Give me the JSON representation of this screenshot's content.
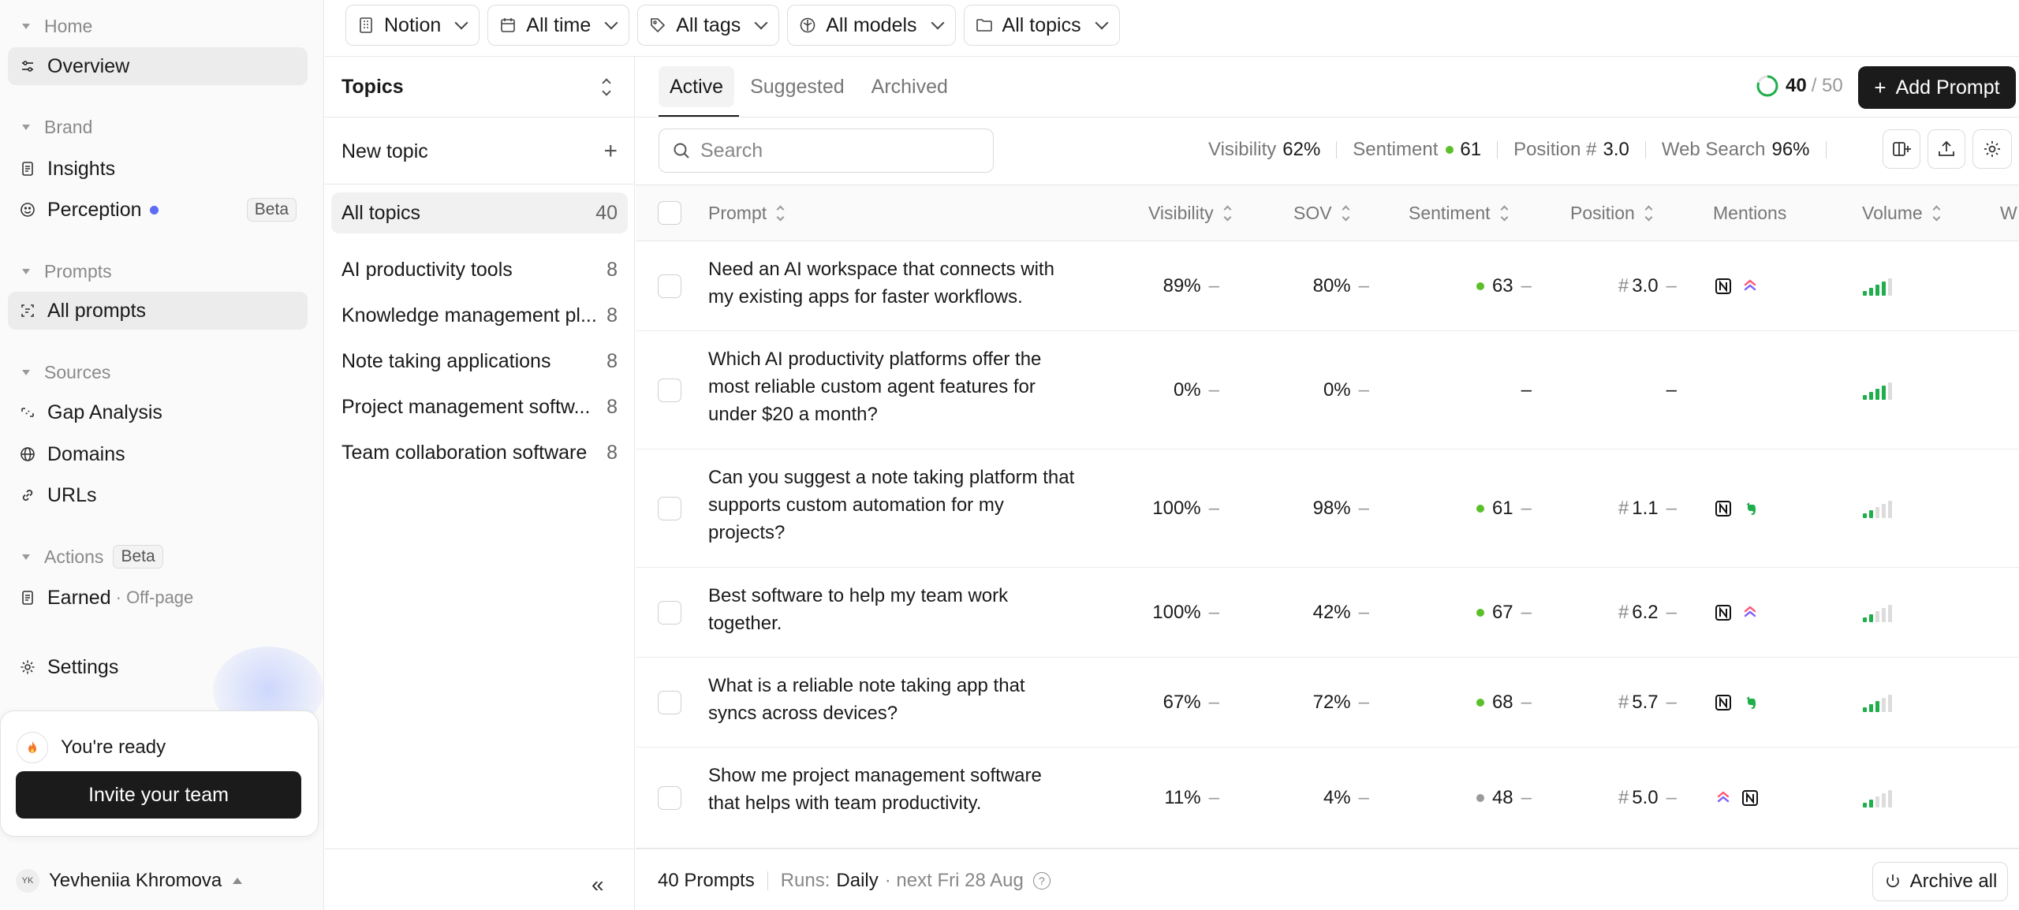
{
  "sidebar": {
    "sections": [
      {
        "label": "Home"
      },
      {
        "label": "Brand"
      },
      {
        "label": "Prompts"
      },
      {
        "label": "Sources"
      },
      {
        "label": "Actions",
        "badge": "Beta"
      }
    ],
    "items": {
      "overview": "Overview",
      "insights": "Insights",
      "perception": "Perception",
      "perception_badge": "Beta",
      "all_prompts": "All prompts",
      "gap_analysis": "Gap Analysis",
      "domains": "Domains",
      "urls": "URLs",
      "earned": "Earned",
      "earned_sub": "· Off-page",
      "settings": "Settings"
    },
    "ready": {
      "title": "You're ready",
      "button": "Invite your team"
    },
    "user": {
      "initials": "YK",
      "name": "Yevheniia Khromova"
    }
  },
  "filters": [
    {
      "label": "Notion",
      "icon": "building-icon"
    },
    {
      "label": "All time",
      "icon": "calendar-icon"
    },
    {
      "label": "All tags",
      "icon": "tag-icon"
    },
    {
      "label": "All models",
      "icon": "model-icon"
    },
    {
      "label": "All topics",
      "icon": "folder-icon"
    }
  ],
  "topics": {
    "header": "Topics",
    "new_topic": "New topic",
    "all": {
      "label": "All topics",
      "count": "40"
    },
    "list": [
      {
        "label": "AI productivity tools",
        "count": "8"
      },
      {
        "label": "Knowledge management pl...",
        "count": "8"
      },
      {
        "label": "Note taking applications",
        "count": "8"
      },
      {
        "label": "Project management softw...",
        "count": "8"
      },
      {
        "label": "Team collaboration software",
        "count": "8"
      }
    ]
  },
  "tabs": [
    "Active",
    "Suggested",
    "Archived"
  ],
  "progress": {
    "current": "40",
    "total": "/ 50",
    "fraction": 0.8
  },
  "add_prompt": "Add Prompt",
  "search": {
    "placeholder": "Search",
    "value": ""
  },
  "stats": {
    "visibility_label": "Visibility",
    "visibility": "62%",
    "sentiment_label": "Sentiment",
    "sentiment": "61",
    "position_label": "Position #",
    "position": "3.0",
    "web_search_label": "Web Search",
    "web_search": "96%"
  },
  "columns": [
    "Prompt",
    "Visibility",
    "SOV",
    "Sentiment",
    "Position",
    "Mentions",
    "Volume",
    "W"
  ],
  "rows": [
    {
      "prompt": [
        "Need an AI workspace that connects with",
        "my existing apps for faster workflows."
      ],
      "visibility": "89%",
      "sov": "80%",
      "sentiment": "63",
      "sentiment_color": "#5bbf2a",
      "position": "3.0",
      "mentions": [
        "notion-icon",
        "clickup-icon"
      ],
      "volume": 4
    },
    {
      "prompt": [
        "Which AI productivity platforms offer the",
        "most reliable custom agent features for",
        "under $20 a month?"
      ],
      "visibility": "0%",
      "sov": "0%",
      "sentiment": "–",
      "sentiment_color": "",
      "position": "–",
      "mentions": [],
      "volume": 4
    },
    {
      "prompt": [
        "Can you suggest a note taking platform that",
        "supports custom automation for my",
        "projects?"
      ],
      "visibility": "100%",
      "sov": "98%",
      "sentiment": "61",
      "sentiment_color": "#5bbf2a",
      "position": "1.1",
      "mentions": [
        "notion-icon",
        "evernote-icon"
      ],
      "volume": 2
    },
    {
      "prompt": [
        "Best software to help my team work",
        "together."
      ],
      "visibility": "100%",
      "sov": "42%",
      "sentiment": "67",
      "sentiment_color": "#5bbf2a",
      "position": "6.2",
      "mentions": [
        "notion-icon",
        "clickup-icon"
      ],
      "volume": 2
    },
    {
      "prompt": [
        "What is a reliable note taking app that",
        "syncs across devices?"
      ],
      "visibility": "67%",
      "sov": "72%",
      "sentiment": "68",
      "sentiment_color": "#5bbf2a",
      "position": "5.7",
      "mentions": [
        "notion-icon",
        "evernote-icon"
      ],
      "volume": 3
    },
    {
      "prompt": [
        "Show me project management software",
        "that helps with team productivity."
      ],
      "visibility": "11%",
      "sov": "4%",
      "sentiment": "48",
      "sentiment_color": "#9a9a9a",
      "position": "5.0",
      "mentions": [
        "clickup-icon",
        "notion-icon"
      ],
      "volume": 2
    }
  ],
  "footer": {
    "count": "40 Prompts",
    "runs_label": "Runs:",
    "runs_value": "Daily",
    "next": "· next Fri 28 Aug",
    "archive_all": "Archive all"
  },
  "colors": {
    "accent": "#1b1b1b",
    "positive": "#5bbf2a",
    "volume": "#1fae4b",
    "beta_dot": "#5b6cf5"
  }
}
